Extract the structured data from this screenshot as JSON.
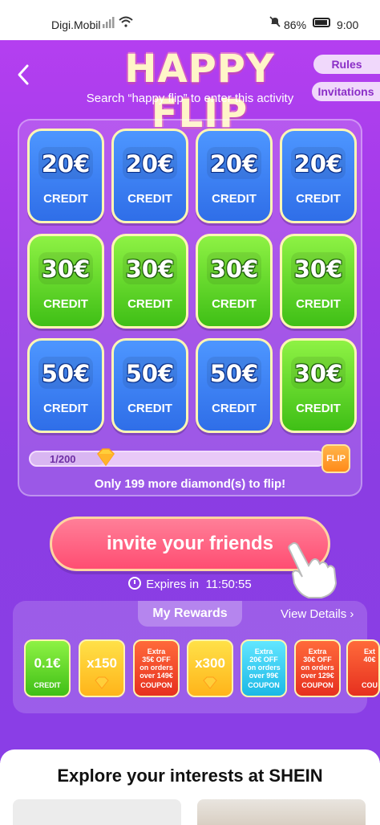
{
  "status_bar": {
    "carrier": "Digi.Mobil",
    "battery": "86%",
    "time": "9:00",
    "icons": [
      "signal-icon",
      "wifi-icon",
      "mute-icon",
      "battery-icon"
    ]
  },
  "header": {
    "back_icon": "chevron-left-icon",
    "title": "HAPPY FLIP",
    "subtitle": "Search “happy flip” to enter this activity",
    "rules_label": "Rules",
    "invitations_label": "Invitations"
  },
  "cards": [
    {
      "amount": "20€",
      "label": "CREDIT",
      "color": "blue"
    },
    {
      "amount": "20€",
      "label": "CREDIT",
      "color": "blue"
    },
    {
      "amount": "20€",
      "label": "CREDIT",
      "color": "blue"
    },
    {
      "amount": "20€",
      "label": "CREDIT",
      "color": "blue"
    },
    {
      "amount": "30€",
      "label": "CREDIT",
      "color": "green"
    },
    {
      "amount": "30€",
      "label": "CREDIT",
      "color": "green"
    },
    {
      "amount": "30€",
      "label": "CREDIT",
      "color": "green"
    },
    {
      "amount": "30€",
      "label": "CREDIT",
      "color": "green"
    },
    {
      "amount": "50€",
      "label": "CREDIT",
      "color": "blue"
    },
    {
      "amount": "50€",
      "label": "CREDIT",
      "color": "blue"
    },
    {
      "amount": "50€",
      "label": "CREDIT",
      "color": "blue"
    },
    {
      "amount": "30€",
      "label": "CREDIT",
      "color": "green"
    }
  ],
  "progress": {
    "count_text": "1/200",
    "fraction": 0.25,
    "flip_label": "FLIP",
    "note": "Only 199 more diamond(s) to flip!"
  },
  "invite": {
    "button_label": "invite your friends",
    "expires_label": "Expires in",
    "expires_time": "11:50:55"
  },
  "rewards": {
    "tab_label": "My Rewards",
    "view_details": "View Details ›",
    "items": [
      {
        "type": "credit",
        "color": "green",
        "big": "0.1€",
        "small": "CREDIT"
      },
      {
        "type": "diamond",
        "color": "yellow",
        "big": "x150"
      },
      {
        "type": "coupon",
        "color": "red",
        "tiny": "Extra\n35€ OFF\non orders over 149€",
        "small": "COUPON"
      },
      {
        "type": "diamond",
        "color": "yellow",
        "big": "x300"
      },
      {
        "type": "coupon",
        "color": "teal",
        "tiny": "Extra\n20€ OFF\non orders over 99€",
        "small": "COUPON"
      },
      {
        "type": "coupon",
        "color": "red",
        "tiny": "Extra\n30€ OFF\non orders over 129€",
        "small": "COUPON"
      },
      {
        "type": "coupon",
        "color": "red",
        "tiny": "Ext\n40€",
        "small": "COU"
      }
    ]
  },
  "explore": {
    "heading": "Explore your interests at SHEIN"
  }
}
